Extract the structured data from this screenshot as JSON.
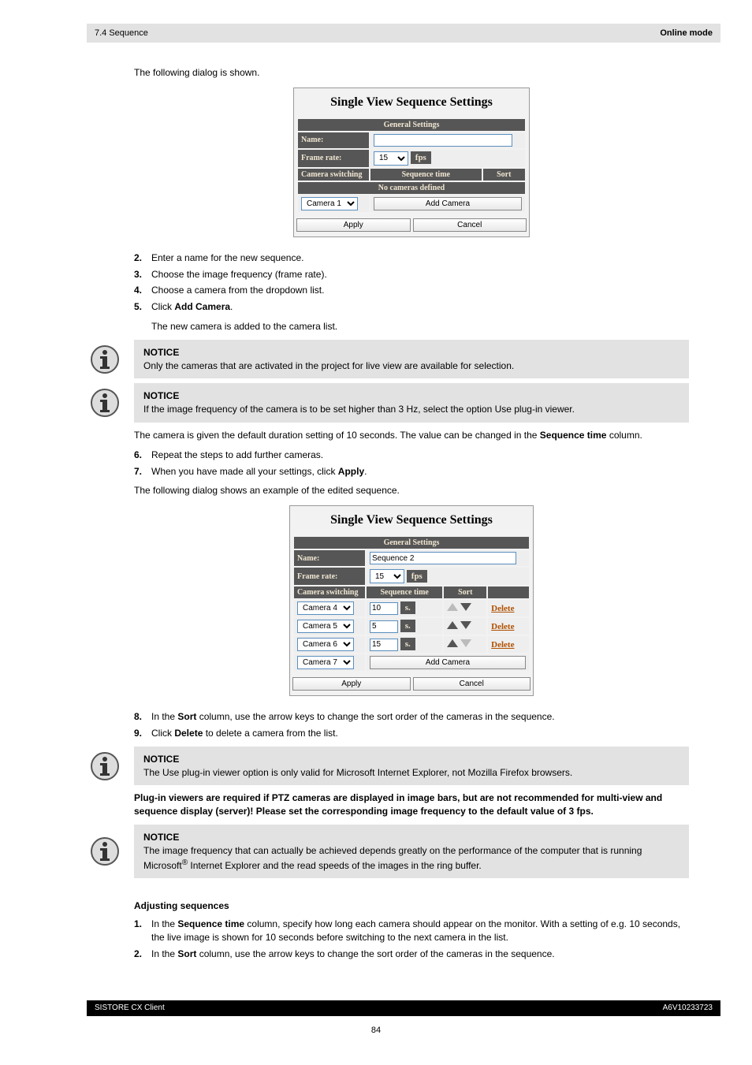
{
  "header": {
    "section": "7.4 Sequence",
    "chapter_title": "Online mode"
  },
  "intro": {
    "p1": "The following dialog is shown.",
    "steps": {
      "s2n": "2.",
      "s2": "Enter a name for the new sequence.",
      "s3n": "3.",
      "s3": "Choose the image frequency (frame rate).",
      "s4n": "4.",
      "s4": "Choose a camera from the dropdown list.",
      "s5n": "5.",
      "s5a": "Click ",
      "s5b": "Add Camera",
      "s5c": "."
    },
    "p2": "The new camera is added to the camera list."
  },
  "note1_h": "NOTICE",
  "note1": "Only the cameras that are activated in the project for live view are available for selection.",
  "note2_h": "NOTICE",
  "note2": "If the image frequency of the camera is to be set higher than 3 Hz, select the option Use plug-in viewer.",
  "mid": {
    "p1a": "The camera is given the default duration setting of 10 seconds. The value can be changed in the ",
    "p1b": "Sequence time",
    "p1c": " column.",
    "steps": {
      "s6n": "6.",
      "s6": "Repeat the steps to add further cameras.",
      "s7n": "7.",
      "s7a": "When you have made all your settings, click ",
      "s7b": "Apply",
      "s7c": ".",
      "s8n": "8.",
      "s8a": "In the ",
      "s8b": "Sort",
      "s8c": " column, use the arrow keys to change the sort order of the cameras in the sequence.",
      "s9n": "9.",
      "s9a": "Click ",
      "s9b": "Delete",
      "s9c": " to delete a camera from the list."
    },
    "p2": "The following dialog shows an example of the edited sequence."
  },
  "note3_h": "NOTICE",
  "note3": "The Use plug-in viewer option is only valid for Microsoft Internet Explorer, not Mozilla Firefox browsers.",
  "bold_para_a": "Plug-in viewers are required if PTZ cameras are displayed in image bars, but are not recommended for multi-view and sequence display (server)! Please set the corresponding image frequency to the default value of 3 fps.",
  "note4_h": "NOTICE",
  "note4a": "The image frequency that can actually be achieved depends greatly on the performance of the computer that is running Microsoft",
  "note4_reg": "®",
  "note4b": " Internet Explorer and the read speeds of the images in the ring buffer.",
  "subhead": "Adjusting sequences",
  "adj": {
    "s1n": "1.",
    "s1a": "In the ",
    "s1b": "Sequence time",
    "s1c": " column, specify how long each camera should appear on the monitor. With a setting of e.g. 10 seconds, the live image is shown for 10 seconds before switching to the next camera in the list.",
    "s2n": "2.",
    "s2a": "In the ",
    "s2b": "Sort",
    "s2c": " column, use the arrow keys to change the sort order of the cameras in the sequence."
  },
  "fig1": {
    "title": "Single View Sequence Settings",
    "general": "General Settings",
    "name_lbl": "Name:",
    "name_val": "",
    "rate_lbl": "Frame rate:",
    "rate_val": "15",
    "fps": "fps",
    "sw_lbl": "Camera switching",
    "seq_lbl": "Sequence time",
    "sort_lbl": "Sort",
    "nocam": "No cameras defined",
    "cam_sel": "Camera 1",
    "add_btn": "Add Camera",
    "apply": "Apply",
    "cancel": "Cancel"
  },
  "fig2": {
    "title": "Single View Sequence Settings",
    "general": "General Settings",
    "name_lbl": "Name:",
    "name_val": "Sequence 2",
    "rate_lbl": "Frame rate:",
    "rate_val": "15",
    "fps": "fps",
    "sw_lbl": "Camera switching",
    "seq_lbl": "Sequence time",
    "sort_lbl": "Sort",
    "rows": [
      {
        "cam": "Camera 4",
        "time": "10",
        "del": "Delete"
      },
      {
        "cam": "Camera 5",
        "time": "5",
        "del": "Delete"
      },
      {
        "cam": "Camera 6",
        "time": "15",
        "del": "Delete"
      }
    ],
    "s_unit": "s.",
    "cam_sel": "Camera 7",
    "add_btn": "Add Camera",
    "apply": "Apply",
    "cancel": "Cancel"
  },
  "footer": {
    "left": "SISTORE CX Client",
    "right": "A6V10233723"
  },
  "pagenum": "84"
}
